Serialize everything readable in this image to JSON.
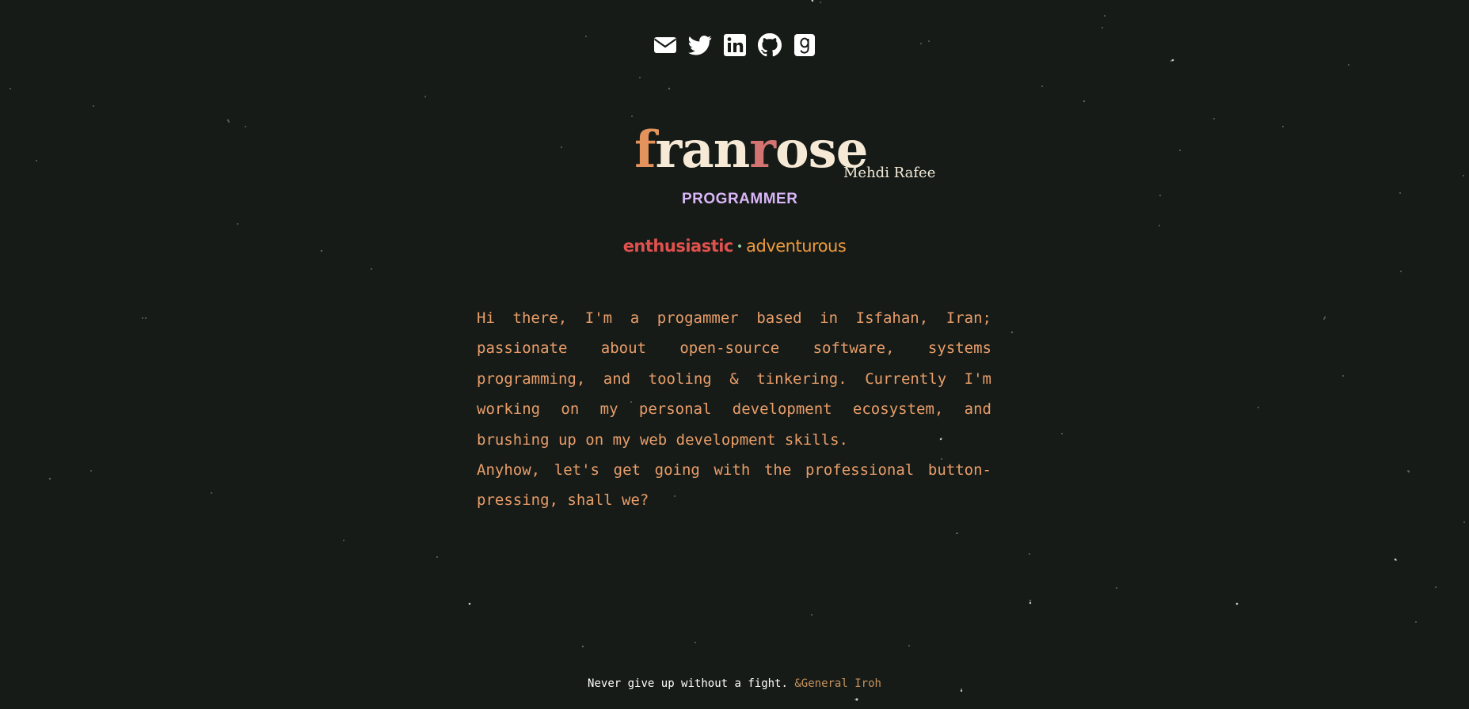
{
  "social": {
    "items": [
      {
        "icon": "email-icon"
      },
      {
        "icon": "twitter-icon"
      },
      {
        "icon": "linkedin-icon"
      },
      {
        "icon": "github-icon"
      },
      {
        "icon": "goodreads-icon"
      }
    ]
  },
  "header": {
    "logo_parts": [
      "f",
      "ran",
      "r",
      "ose"
    ],
    "author": "Mehdi Rafee",
    "role": "PROGRAMMER"
  },
  "traits": {
    "first": "enthusiastic",
    "separator": "•",
    "second": "adventurous"
  },
  "bio": {
    "paragraph1": "Hi there, I'm a progammer based in Isfahan, Iran; passionate about open-source software, systems programming, and tooling & tinkering. Currently I'm working on my personal development ecosystem, and brushing up on my web development skills.",
    "paragraph2": "Anyhow, let's get going with the professional button-pressing, shall we?"
  },
  "footer": {
    "quote": "Never give up without a fight.",
    "author": "&General Iroh"
  },
  "colors": {
    "background": "#161b17",
    "logo_accent_1": "#e3935b",
    "logo_accent_2": "#d37473",
    "logo_main": "#f6ead6",
    "role": "#d9b6f7",
    "trait_1": "#e0514e",
    "trait_2": "#ec9a3d",
    "bio_text": "#e89d6a",
    "quote_author": "#c7935e"
  }
}
